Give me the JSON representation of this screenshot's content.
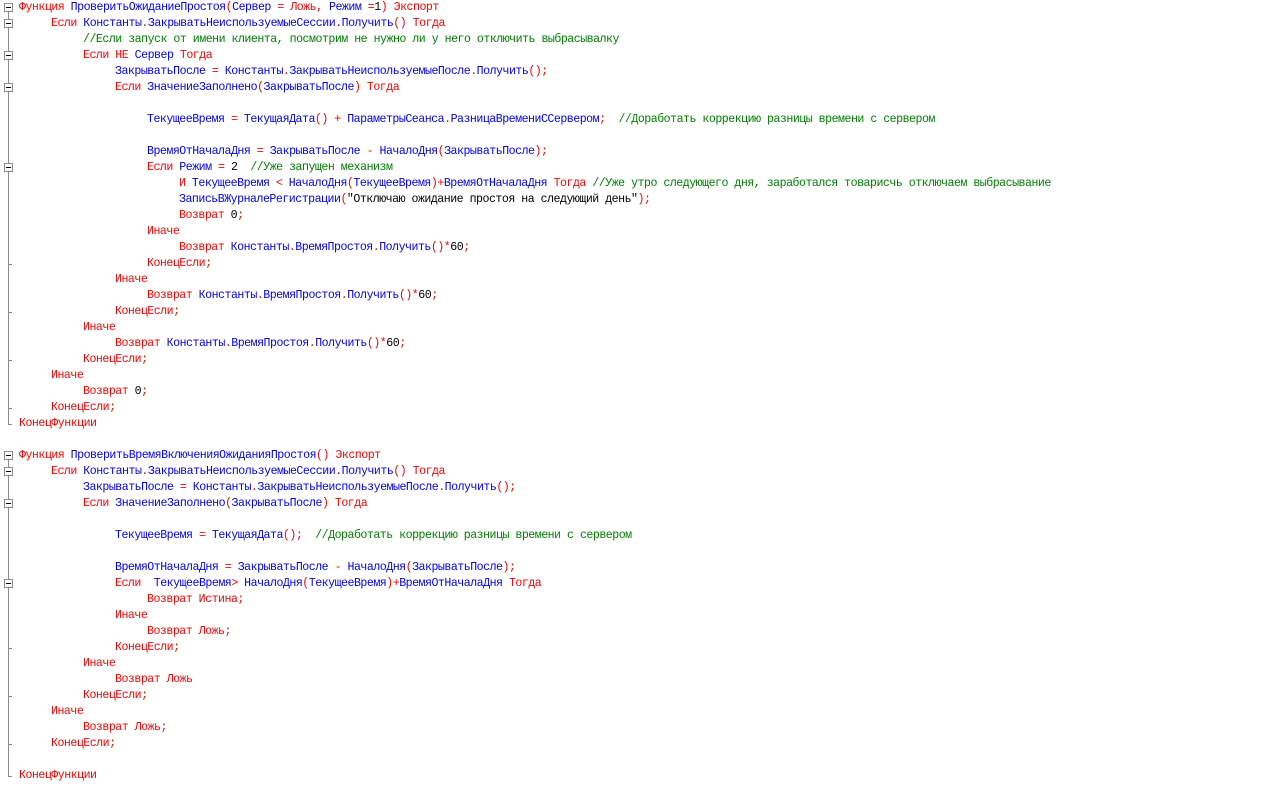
{
  "colors": {
    "keyword": "#FF0000",
    "identifier": "#0000FF",
    "comment": "#008000",
    "string": "#000000",
    "number": "#000000",
    "fold_guide": "#8A8A8A"
  },
  "lines": [
    {
      "indent": 0,
      "gutter": "fold",
      "tokens": [
        [
          "kw",
          "Функция"
        ],
        [
          "id",
          " ПроверитьОжиданиеПростоя"
        ],
        [
          "op",
          "("
        ],
        [
          "id",
          "Сервер "
        ],
        [
          "op",
          "="
        ],
        [
          "kw",
          " Ложь"
        ],
        [
          "op",
          ","
        ],
        [
          "id",
          " Режим "
        ],
        [
          "op",
          "="
        ],
        [
          "nm",
          "1"
        ],
        [
          "op",
          ")"
        ],
        [
          "kw",
          " Экспорт"
        ]
      ]
    },
    {
      "indent": 1,
      "gutter": "fold",
      "tokens": [
        [
          "kw",
          "Если"
        ],
        [
          "id",
          " Константы"
        ],
        [
          "op",
          "."
        ],
        [
          "id",
          "ЗакрыватьНеиспользуемыеСессии"
        ],
        [
          "op",
          "."
        ],
        [
          "id",
          "Получить"
        ],
        [
          "op",
          "()"
        ],
        [
          "kw",
          " Тогда"
        ]
      ]
    },
    {
      "indent": 2,
      "gutter": "line",
      "tokens": [
        [
          "cm",
          "//Если запуск от имени клиента, посмотрим не нужно ли у него отключить выбрасывалку"
        ]
      ]
    },
    {
      "indent": 2,
      "gutter": "fold",
      "tokens": [
        [
          "kw",
          "Если НЕ"
        ],
        [
          "id",
          " Сервер"
        ],
        [
          "kw",
          " Тогда"
        ]
      ]
    },
    {
      "indent": 3,
      "gutter": "line",
      "tokens": [
        [
          "id",
          "ЗакрыватьПосле "
        ],
        [
          "op",
          "="
        ],
        [
          "id",
          " Константы"
        ],
        [
          "op",
          "."
        ],
        [
          "id",
          "ЗакрыватьНеиспользуемыеПосле"
        ],
        [
          "op",
          "."
        ],
        [
          "id",
          "Получить"
        ],
        [
          "op",
          "();"
        ]
      ]
    },
    {
      "indent": 3,
      "gutter": "fold",
      "tokens": [
        [
          "kw",
          "Если"
        ],
        [
          "id",
          " ЗначениеЗаполнено"
        ],
        [
          "op",
          "("
        ],
        [
          "id",
          "ЗакрыватьПосле"
        ],
        [
          "op",
          ")"
        ],
        [
          "kw",
          " Тогда"
        ]
      ]
    },
    {
      "indent": 0,
      "gutter": "line",
      "tokens": []
    },
    {
      "indent": 4,
      "gutter": "line",
      "tokens": [
        [
          "id",
          "ТекущееВремя "
        ],
        [
          "op",
          "="
        ],
        [
          "id",
          " ТекущаяДата"
        ],
        [
          "op",
          "()"
        ],
        [
          "op",
          " +"
        ],
        [
          "id",
          " ПараметрыСеанса"
        ],
        [
          "op",
          "."
        ],
        [
          "id",
          "РазницаВремениССервером"
        ],
        [
          "op",
          ";"
        ],
        [
          "cm",
          "  //Доработать коррекцию разницы времени с сервером"
        ]
      ]
    },
    {
      "indent": 0,
      "gutter": "line",
      "tokens": []
    },
    {
      "indent": 4,
      "gutter": "line",
      "tokens": [
        [
          "id",
          "ВремяОтНачалаДня "
        ],
        [
          "op",
          "="
        ],
        [
          "id",
          " ЗакрыватьПосле "
        ],
        [
          "op",
          "-"
        ],
        [
          "id",
          " НачалоДня"
        ],
        [
          "op",
          "("
        ],
        [
          "id",
          "ЗакрыватьПосле"
        ],
        [
          "op",
          ");"
        ]
      ]
    },
    {
      "indent": 4,
      "gutter": "fold",
      "tokens": [
        [
          "kw",
          "Если"
        ],
        [
          "id",
          " Режим "
        ],
        [
          "op",
          "="
        ],
        [
          "nm",
          " 2"
        ],
        [
          "cm",
          "  //Уже запущен механизм"
        ]
      ]
    },
    {
      "indent": 5,
      "gutter": "line",
      "tokens": [
        [
          "kw",
          "И"
        ],
        [
          "id",
          " ТекущееВремя "
        ],
        [
          "op",
          "<"
        ],
        [
          "id",
          " НачалоДня"
        ],
        [
          "op",
          "("
        ],
        [
          "id",
          "ТекущееВремя"
        ],
        [
          "op",
          ")+"
        ],
        [
          "id",
          "ВремяОтНачалаДня"
        ],
        [
          "kw",
          " Тогда"
        ],
        [
          "cm",
          " //Уже утро следующего дня, заработался товарисчь отключаем выбрасывание"
        ]
      ]
    },
    {
      "indent": 5,
      "gutter": "line",
      "tokens": [
        [
          "id",
          "ЗаписьВЖурналеРегистрации"
        ],
        [
          "op",
          "("
        ],
        [
          "st",
          "\"Отключаю ожидание простоя на следующий день\""
        ],
        [
          "op",
          ");"
        ]
      ]
    },
    {
      "indent": 5,
      "gutter": "line",
      "tokens": [
        [
          "kw",
          "Возврат"
        ],
        [
          "nm",
          " 0"
        ],
        [
          "op",
          ";"
        ]
      ]
    },
    {
      "indent": 4,
      "gutter": "line",
      "tokens": [
        [
          "kw",
          "Иначе"
        ]
      ]
    },
    {
      "indent": 5,
      "gutter": "line",
      "tokens": [
        [
          "kw",
          "Возврат"
        ],
        [
          "id",
          " Константы"
        ],
        [
          "op",
          "."
        ],
        [
          "id",
          "ВремяПростоя"
        ],
        [
          "op",
          "."
        ],
        [
          "id",
          "Получить"
        ],
        [
          "op",
          "()*"
        ],
        [
          "nm",
          "60"
        ],
        [
          "op",
          ";"
        ]
      ]
    },
    {
      "indent": 4,
      "gutter": "tick",
      "tokens": [
        [
          "kw",
          "КонецЕсли;"
        ]
      ]
    },
    {
      "indent": 3,
      "gutter": "line",
      "tokens": [
        [
          "kw",
          "Иначе"
        ]
      ]
    },
    {
      "indent": 4,
      "gutter": "line",
      "tokens": [
        [
          "kw",
          "Возврат"
        ],
        [
          "id",
          " Константы"
        ],
        [
          "op",
          "."
        ],
        [
          "id",
          "ВремяПростоя"
        ],
        [
          "op",
          "."
        ],
        [
          "id",
          "Получить"
        ],
        [
          "op",
          "()*"
        ],
        [
          "nm",
          "60"
        ],
        [
          "op",
          ";"
        ]
      ]
    },
    {
      "indent": 3,
      "gutter": "tick",
      "tokens": [
        [
          "kw",
          "КонецЕсли;"
        ]
      ]
    },
    {
      "indent": 2,
      "gutter": "line",
      "tokens": [
        [
          "kw",
          "Иначе"
        ]
      ]
    },
    {
      "indent": 3,
      "gutter": "line",
      "tokens": [
        [
          "kw",
          "Возврат"
        ],
        [
          "id",
          " Константы"
        ],
        [
          "op",
          "."
        ],
        [
          "id",
          "ВремяПростоя"
        ],
        [
          "op",
          "."
        ],
        [
          "id",
          "Получить"
        ],
        [
          "op",
          "()*"
        ],
        [
          "nm",
          "60"
        ],
        [
          "op",
          ";"
        ]
      ]
    },
    {
      "indent": 2,
      "gutter": "tick",
      "tokens": [
        [
          "kw",
          "КонецЕсли;"
        ]
      ]
    },
    {
      "indent": 1,
      "gutter": "line",
      "tokens": [
        [
          "kw",
          "Иначе"
        ]
      ]
    },
    {
      "indent": 2,
      "gutter": "line",
      "tokens": [
        [
          "kw",
          "Возврат"
        ],
        [
          "nm",
          " 0"
        ],
        [
          "op",
          ";"
        ]
      ]
    },
    {
      "indent": 1,
      "gutter": "tick",
      "tokens": [
        [
          "kw",
          "КонецЕсли;"
        ]
      ]
    },
    {
      "indent": 0,
      "gutter": "end",
      "tokens": [
        [
          "kw",
          "КонецФункции"
        ]
      ]
    },
    {
      "indent": 0,
      "gutter": "none",
      "tokens": []
    },
    {
      "indent": 0,
      "gutter": "fold",
      "tokens": [
        [
          "kw",
          "Функция"
        ],
        [
          "id",
          " ПроверитьВремяВключенияОжиданияПростоя"
        ],
        [
          "op",
          "()"
        ],
        [
          "kw",
          " Экспорт"
        ]
      ]
    },
    {
      "indent": 1,
      "gutter": "fold",
      "tokens": [
        [
          "kw",
          "Если"
        ],
        [
          "id",
          " Константы"
        ],
        [
          "op",
          "."
        ],
        [
          "id",
          "ЗакрыватьНеиспользуемыеСессии"
        ],
        [
          "op",
          "."
        ],
        [
          "id",
          "Получить"
        ],
        [
          "op",
          "()"
        ],
        [
          "kw",
          " Тогда"
        ]
      ]
    },
    {
      "indent": 2,
      "gutter": "line",
      "tokens": [
        [
          "id",
          "ЗакрыватьПосле "
        ],
        [
          "op",
          "="
        ],
        [
          "id",
          " Константы"
        ],
        [
          "op",
          "."
        ],
        [
          "id",
          "ЗакрыватьНеиспользуемыеПосле"
        ],
        [
          "op",
          "."
        ],
        [
          "id",
          "Получить"
        ],
        [
          "op",
          "();"
        ]
      ]
    },
    {
      "indent": 2,
      "gutter": "fold",
      "tokens": [
        [
          "kw",
          "Если"
        ],
        [
          "id",
          " ЗначениеЗаполнено"
        ],
        [
          "op",
          "("
        ],
        [
          "id",
          "ЗакрыватьПосле"
        ],
        [
          "op",
          ")"
        ],
        [
          "kw",
          " Тогда"
        ]
      ]
    },
    {
      "indent": 0,
      "gutter": "line",
      "tokens": []
    },
    {
      "indent": 3,
      "gutter": "line",
      "tokens": [
        [
          "id",
          "ТекущееВремя "
        ],
        [
          "op",
          "="
        ],
        [
          "id",
          " ТекущаяДата"
        ],
        [
          "op",
          "();"
        ],
        [
          "cm",
          "  //Доработать коррекцию разницы времени с сервером"
        ]
      ]
    },
    {
      "indent": 0,
      "gutter": "line",
      "tokens": []
    },
    {
      "indent": 3,
      "gutter": "line",
      "tokens": [
        [
          "id",
          "ВремяОтНачалаДня "
        ],
        [
          "op",
          "="
        ],
        [
          "id",
          " ЗакрыватьПосле "
        ],
        [
          "op",
          "-"
        ],
        [
          "id",
          " НачалоДня"
        ],
        [
          "op",
          "("
        ],
        [
          "id",
          "ЗакрыватьПосле"
        ],
        [
          "op",
          ");"
        ]
      ]
    },
    {
      "indent": 3,
      "gutter": "fold",
      "tokens": [
        [
          "kw",
          "Если"
        ],
        [
          "id",
          "  ТекущееВремя"
        ],
        [
          "op",
          ">"
        ],
        [
          "id",
          " НачалоДня"
        ],
        [
          "op",
          "("
        ],
        [
          "id",
          "ТекущееВремя"
        ],
        [
          "op",
          ")+"
        ],
        [
          "id",
          "ВремяОтНачалаДня"
        ],
        [
          "kw",
          " Тогда"
        ]
      ]
    },
    {
      "indent": 4,
      "gutter": "line",
      "tokens": [
        [
          "kw",
          "Возврат Истина;"
        ]
      ]
    },
    {
      "indent": 3,
      "gutter": "line",
      "tokens": [
        [
          "kw",
          "Иначе"
        ]
      ]
    },
    {
      "indent": 4,
      "gutter": "line",
      "tokens": [
        [
          "kw",
          "Возврат Ложь;"
        ]
      ]
    },
    {
      "indent": 3,
      "gutter": "tick",
      "tokens": [
        [
          "kw",
          "КонецЕсли;"
        ]
      ]
    },
    {
      "indent": 2,
      "gutter": "line",
      "tokens": [
        [
          "kw",
          "Иначе"
        ]
      ]
    },
    {
      "indent": 3,
      "gutter": "line",
      "tokens": [
        [
          "kw",
          "Возврат Ложь"
        ]
      ]
    },
    {
      "indent": 2,
      "gutter": "tick",
      "tokens": [
        [
          "kw",
          "КонецЕсли;"
        ]
      ]
    },
    {
      "indent": 1,
      "gutter": "line",
      "tokens": [
        [
          "kw",
          "Иначе"
        ]
      ]
    },
    {
      "indent": 2,
      "gutter": "line",
      "tokens": [
        [
          "kw",
          "Возврат Ложь;"
        ]
      ]
    },
    {
      "indent": 1,
      "gutter": "tick",
      "tokens": [
        [
          "kw",
          "КонецЕсли;"
        ]
      ]
    },
    {
      "indent": 0,
      "gutter": "line",
      "tokens": []
    },
    {
      "indent": 0,
      "gutter": "end",
      "tokens": [
        [
          "kw",
          "КонецФункции"
        ]
      ]
    }
  ]
}
